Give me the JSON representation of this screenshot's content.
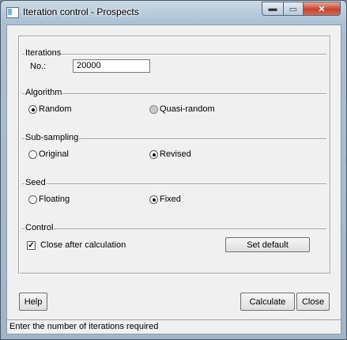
{
  "window": {
    "title": "Iteration control - Prospects"
  },
  "titlebar": {
    "min_glyph": "▬",
    "max_glyph": "▭",
    "close_glyph": "✕"
  },
  "iterations": {
    "group_label": "Iterations",
    "no_label": "No.:",
    "value": "20000"
  },
  "algorithm": {
    "group_label": "Algorithm",
    "options": [
      {
        "label": "Random",
        "checked": true,
        "enabled": true
      },
      {
        "label": "Quasi-random",
        "checked": false,
        "enabled": false
      }
    ]
  },
  "subsampling": {
    "group_label": "Sub-sampling",
    "options": [
      {
        "label": "Original",
        "checked": false
      },
      {
        "label": "Revised",
        "checked": true
      }
    ]
  },
  "seed": {
    "group_label": "Seed",
    "options": [
      {
        "label": "Floating",
        "checked": false
      },
      {
        "label": "Fixed",
        "checked": true
      }
    ]
  },
  "control": {
    "group_label": "Control",
    "close_after_label": "Close after calculation",
    "close_after_checked": true,
    "check_glyph": "✓",
    "set_default_label": "Set default"
  },
  "buttons": {
    "help": "Help",
    "calculate": "Calculate",
    "close": "Close"
  },
  "status": {
    "text": "Enter the number of iterations required"
  }
}
